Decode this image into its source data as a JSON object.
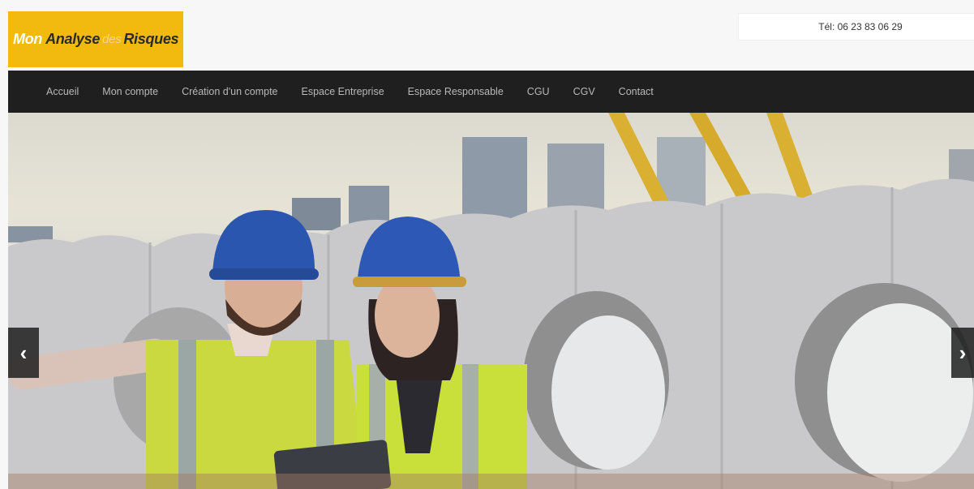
{
  "logo": {
    "word1": "Mon",
    "word2": "Analyse",
    "word3": "des",
    "word4": "Risques"
  },
  "contact": {
    "phone": "Tél: 06 23 83 06 29"
  },
  "nav": {
    "items": [
      {
        "label": "Accueil"
      },
      {
        "label": "Mon compte"
      },
      {
        "label": "Création d'un compte"
      },
      {
        "label": "Espace Entreprise"
      },
      {
        "label": "Espace Responsable"
      },
      {
        "label": "CGU"
      },
      {
        "label": "CGV"
      },
      {
        "label": "Contact"
      }
    ]
  },
  "carousel": {
    "prev_glyph": "‹",
    "next_glyph": "›",
    "slide_description_icon": "construction-workers-photo"
  },
  "colors": {
    "brand": "#f2b90f",
    "nav_bg": "#1f1f1f",
    "vest": "#c8e03a",
    "helmet": "#2b56b0"
  }
}
